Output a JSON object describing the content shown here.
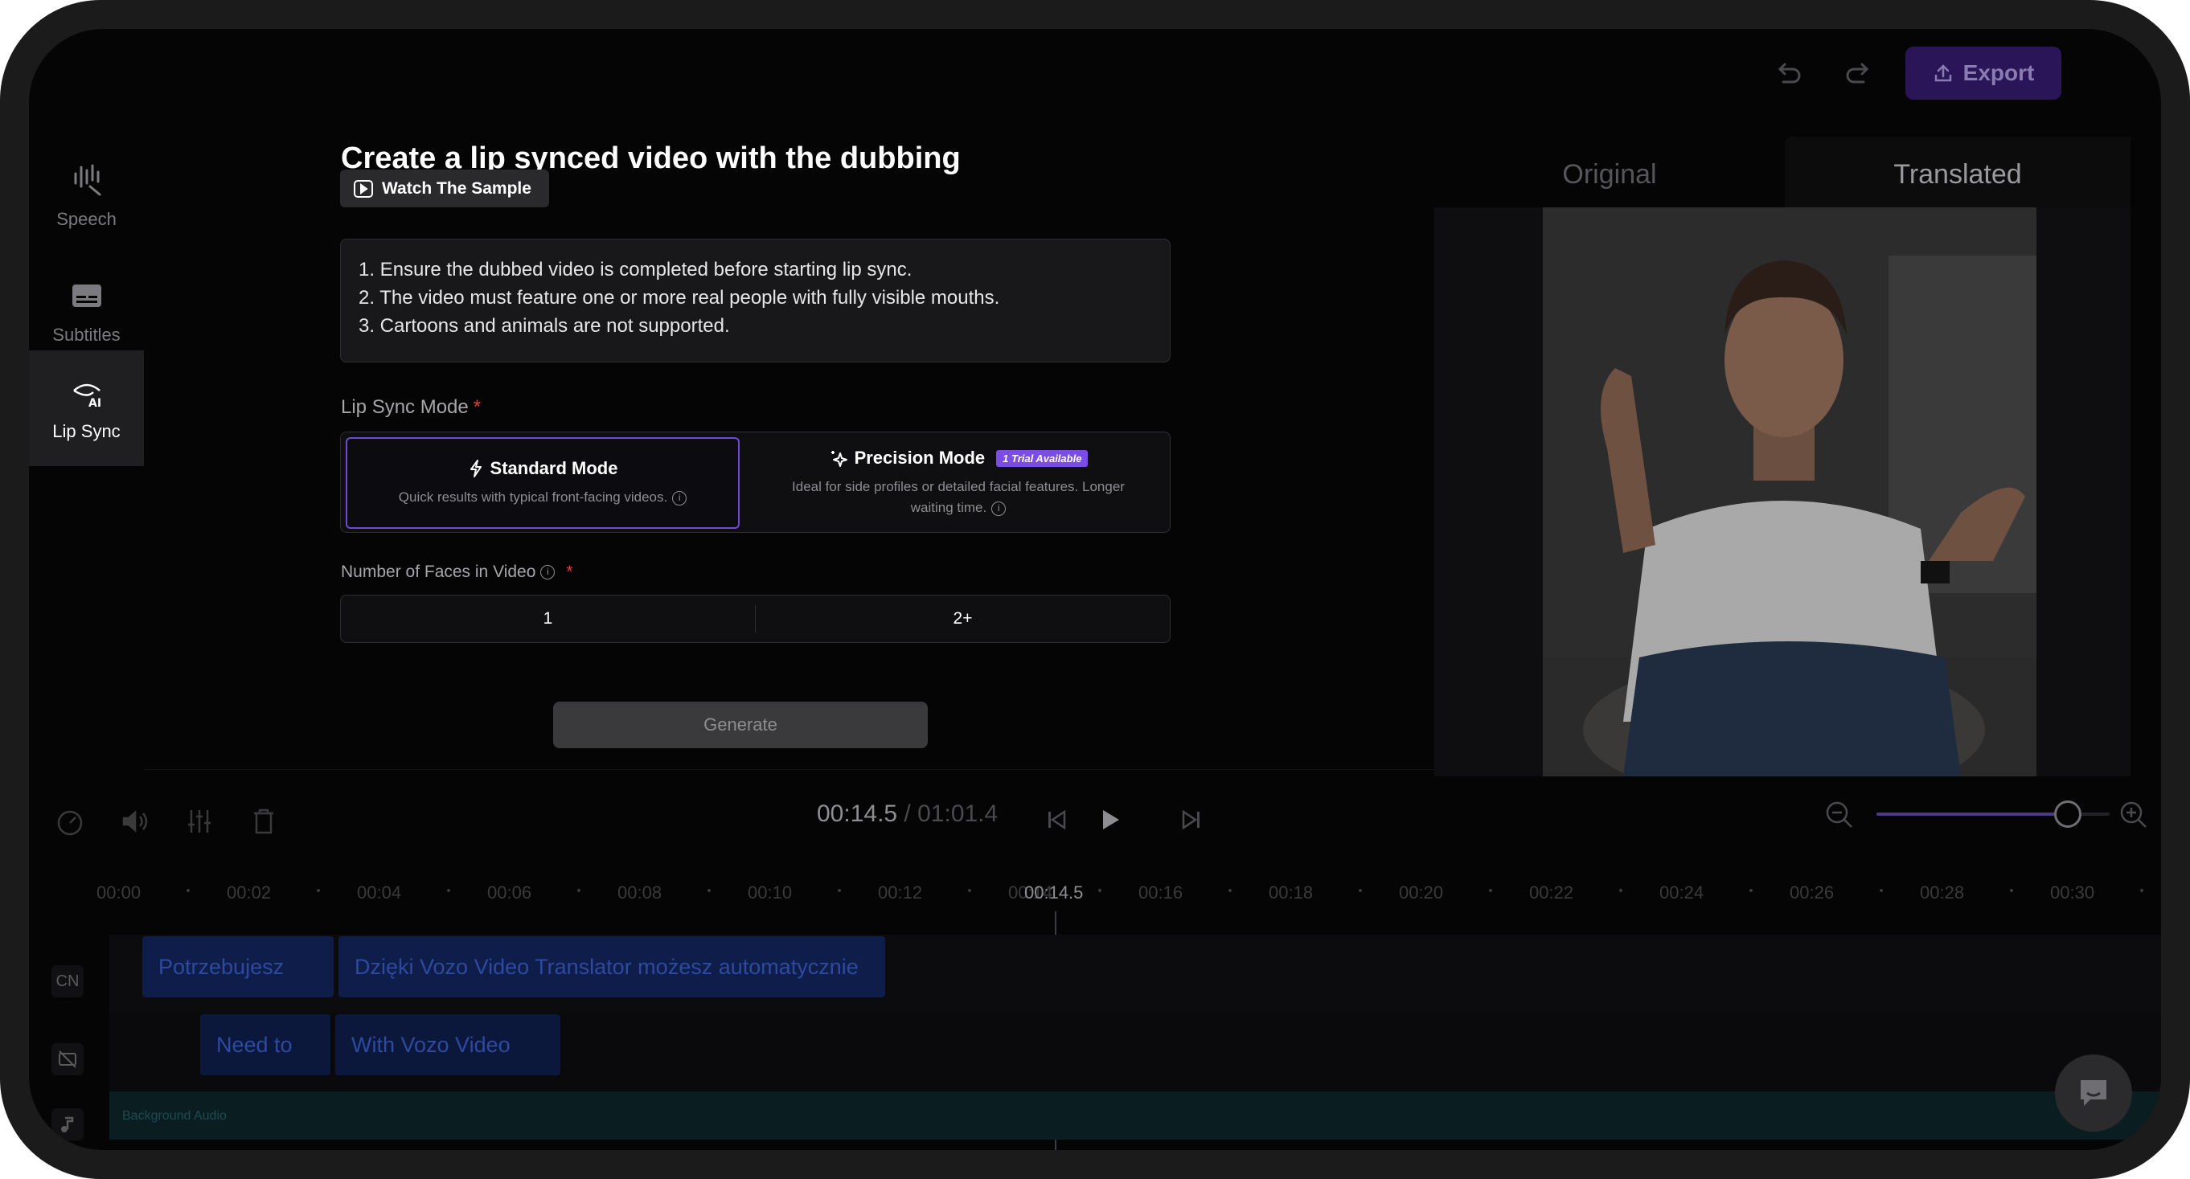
{
  "sidebar": {
    "items": [
      {
        "label": "Speech",
        "icon": "waveform-icon"
      },
      {
        "label": "Subtitles",
        "icon": "subtitles-icon"
      },
      {
        "label": "Lip Sync",
        "icon": "lip-sync-ai-icon",
        "active": true
      }
    ]
  },
  "header": {
    "export_label": "Export",
    "undo_icon": "undo-icon",
    "redo_icon": "redo-icon"
  },
  "panel": {
    "title": "Create a lip synced video with the dubbing",
    "sample_button": "Watch The Sample",
    "notes": [
      "1. Ensure the dubbed video is completed before starting lip sync.",
      "2. The video must feature one or more real people with fully visible mouths.",
      "3. Cartoons and animals are not supported."
    ],
    "lip_sync_mode_label": "Lip Sync Mode",
    "required_mark": "*",
    "modes": {
      "standard": {
        "title": "Standard Mode",
        "description": "Quick results with typical front-facing videos."
      },
      "precision": {
        "title": "Precision Mode",
        "badge": "1 Trial Available",
        "description_line1": "Ideal for side profiles or detailed facial features. Longer",
        "description_line2": "waiting time."
      }
    },
    "faces_label": "Number of Faces in Video",
    "faces_options": [
      "1",
      "2+"
    ],
    "generate_label": "Generate"
  },
  "preview": {
    "tabs": [
      "Original",
      "Translated"
    ],
    "active_tab": "Translated"
  },
  "player": {
    "current_time": "00:14.5",
    "separator": " / ",
    "total_time": "01:01.4",
    "zoom_level": 0.82
  },
  "timeline": {
    "ticks": [
      "00:00",
      "00:02",
      "00:04",
      "00:06",
      "00:08",
      "00:10",
      "00:12",
      "00:14",
      "00:16",
      "00:18",
      "00:20",
      "00:22",
      "00:24",
      "00:26",
      "00:28",
      "00:30"
    ],
    "playhead_label": "00:14.5",
    "tracks": {
      "cn_label": "CN",
      "cn_clips": [
        "Potrzebujesz",
        "Dzięki Vozo Video Translator możesz automatycznie"
      ],
      "original_clips": [
        "Need to",
        "With Vozo Video"
      ],
      "background_label": "Background Audio"
    }
  },
  "colors": {
    "accent": "#7c4ce6",
    "export_bg": "#2b1559",
    "clip_blue": "#0f1f4d"
  }
}
